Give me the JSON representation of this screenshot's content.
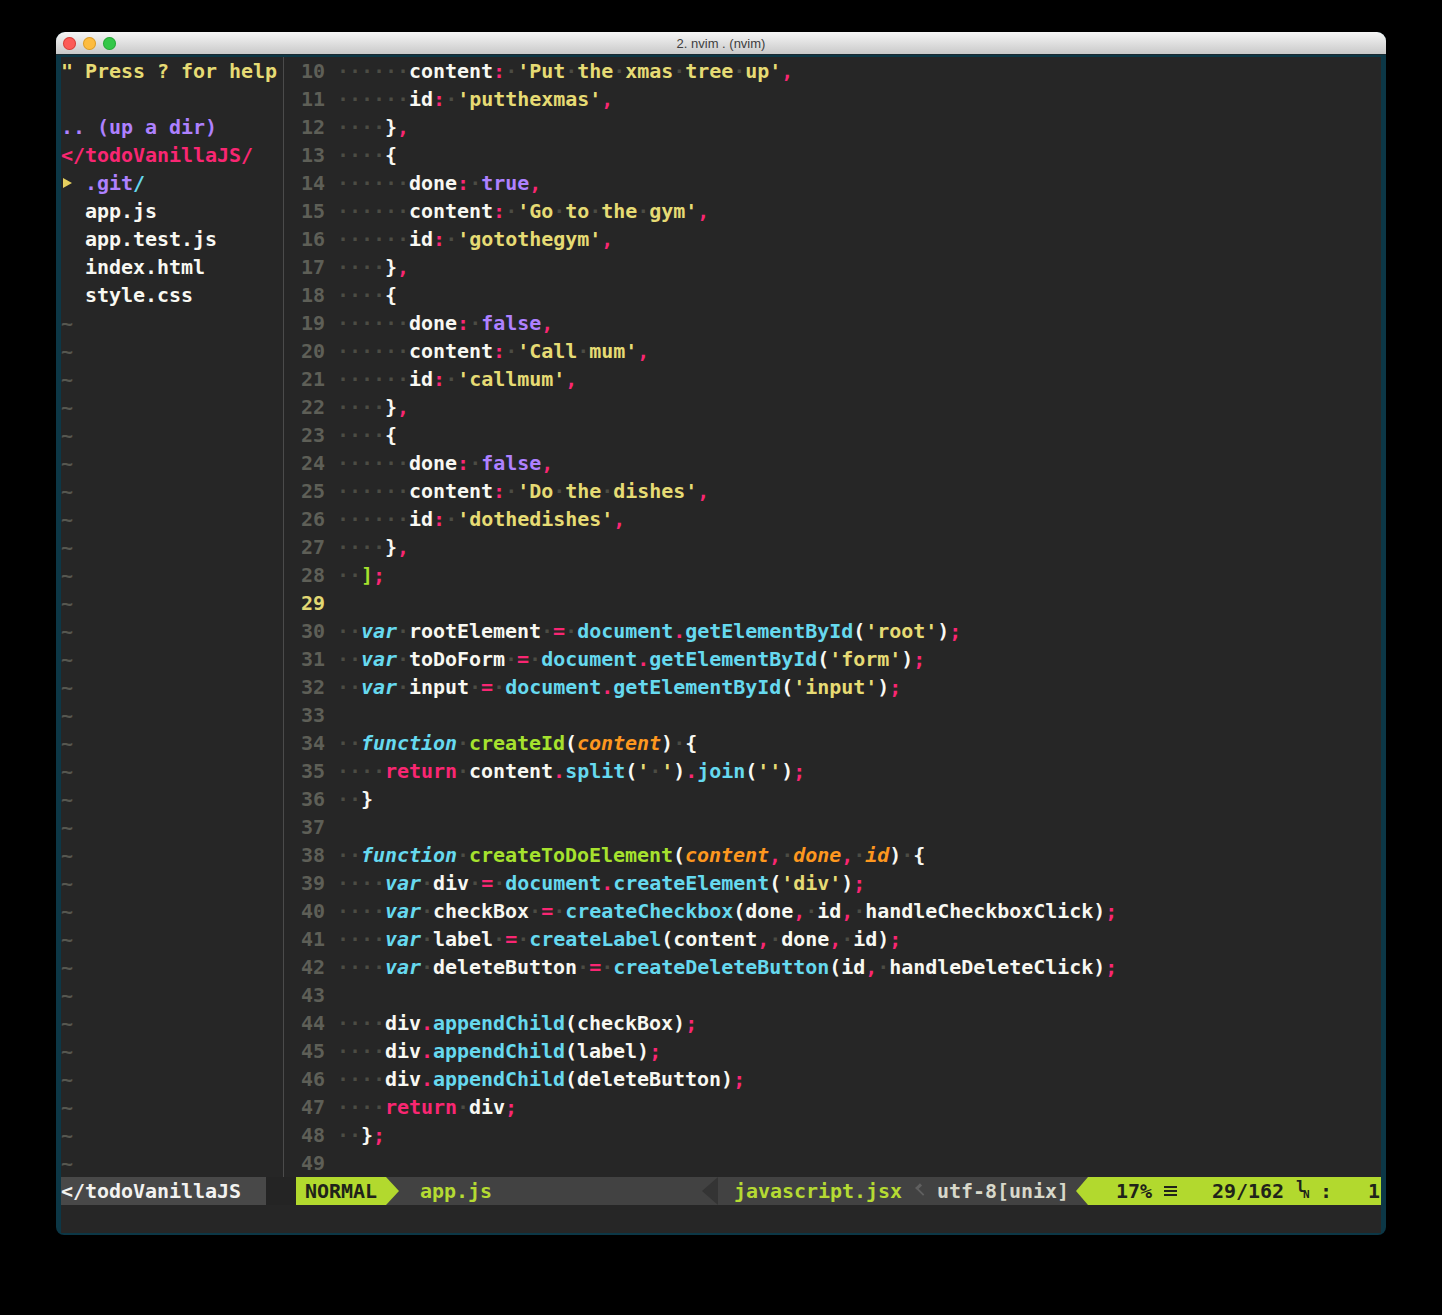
{
  "window": {
    "title": "2. nvim . (nvim)",
    "traffic_lights": [
      "close",
      "minimize",
      "zoom"
    ]
  },
  "sidebar": {
    "help_line": "\" Press ? for help",
    "up_dir": ".. (up a dir)",
    "root": "</todoVanillaJS/",
    "dir_arrow": "▸",
    "dir_name": ".git",
    "dir_slash": "/",
    "files": [
      "app.js",
      "app.test.js",
      "index.html",
      "style.css"
    ],
    "tilde": "~",
    "tilde_count": 31
  },
  "editor": {
    "lines": [
      {
        "n": "10",
        "t": [
          [
            "w",
            "      content"
          ],
          [
            "p",
            ":"
          ],
          [
            "w",
            " "
          ],
          [
            "y",
            "'Put the xmas tree up'"
          ],
          [
            "p",
            ","
          ]
        ]
      },
      {
        "n": "11",
        "t": [
          [
            "w",
            "      id"
          ],
          [
            "p",
            ":"
          ],
          [
            "w",
            " "
          ],
          [
            "y",
            "'putthexmas'"
          ],
          [
            "p",
            ","
          ]
        ]
      },
      {
        "n": "12",
        "t": [
          [
            "w",
            "    }"
          ],
          [
            "p",
            ","
          ]
        ]
      },
      {
        "n": "13",
        "t": [
          [
            "w",
            "    {"
          ]
        ]
      },
      {
        "n": "14",
        "t": [
          [
            "w",
            "      done"
          ],
          [
            "p",
            ":"
          ],
          [
            "w",
            " "
          ],
          [
            "v",
            "true"
          ],
          [
            "p",
            ","
          ]
        ]
      },
      {
        "n": "15",
        "t": [
          [
            "w",
            "      content"
          ],
          [
            "p",
            ":"
          ],
          [
            "w",
            " "
          ],
          [
            "y",
            "'Go to the gym'"
          ],
          [
            "p",
            ","
          ]
        ]
      },
      {
        "n": "16",
        "t": [
          [
            "w",
            "      id"
          ],
          [
            "p",
            ":"
          ],
          [
            "w",
            " "
          ],
          [
            "y",
            "'gotothegym'"
          ],
          [
            "p",
            ","
          ]
        ]
      },
      {
        "n": "17",
        "t": [
          [
            "w",
            "    }"
          ],
          [
            "p",
            ","
          ]
        ]
      },
      {
        "n": "18",
        "t": [
          [
            "w",
            "    {"
          ]
        ]
      },
      {
        "n": "19",
        "t": [
          [
            "w",
            "      done"
          ],
          [
            "p",
            ":"
          ],
          [
            "w",
            " "
          ],
          [
            "v",
            "false"
          ],
          [
            "p",
            ","
          ]
        ]
      },
      {
        "n": "20",
        "t": [
          [
            "w",
            "      content"
          ],
          [
            "p",
            ":"
          ],
          [
            "w",
            " "
          ],
          [
            "y",
            "'Call mum'"
          ],
          [
            "p",
            ","
          ]
        ]
      },
      {
        "n": "21",
        "t": [
          [
            "w",
            "      id"
          ],
          [
            "p",
            ":"
          ],
          [
            "w",
            " "
          ],
          [
            "y",
            "'callmum'"
          ],
          [
            "p",
            ","
          ]
        ]
      },
      {
        "n": "22",
        "t": [
          [
            "w",
            "    }"
          ],
          [
            "p",
            ","
          ]
        ]
      },
      {
        "n": "23",
        "t": [
          [
            "w",
            "    {"
          ]
        ]
      },
      {
        "n": "24",
        "t": [
          [
            "w",
            "      done"
          ],
          [
            "p",
            ":"
          ],
          [
            "w",
            " "
          ],
          [
            "v",
            "false"
          ],
          [
            "p",
            ","
          ]
        ]
      },
      {
        "n": "25",
        "t": [
          [
            "w",
            "      content"
          ],
          [
            "p",
            ":"
          ],
          [
            "w",
            " "
          ],
          [
            "y",
            "'Do the dishes'"
          ],
          [
            "p",
            ","
          ]
        ]
      },
      {
        "n": "26",
        "t": [
          [
            "w",
            "      id"
          ],
          [
            "p",
            ":"
          ],
          [
            "w",
            " "
          ],
          [
            "y",
            "'dothedishes'"
          ],
          [
            "p",
            ","
          ]
        ]
      },
      {
        "n": "27",
        "t": [
          [
            "w",
            "    }"
          ],
          [
            "p",
            ","
          ]
        ]
      },
      {
        "n": "28",
        "t": [
          [
            "w",
            "  "
          ],
          [
            "g",
            "]"
          ],
          [
            "p",
            ";"
          ]
        ]
      },
      {
        "n": "29",
        "cur": true,
        "t": []
      },
      {
        "n": "30",
        "t": [
          [
            "w",
            "  "
          ],
          [
            "k",
            "var"
          ],
          [
            "w",
            " rootElement "
          ],
          [
            "p",
            "="
          ],
          [
            "w",
            " "
          ],
          [
            "c",
            "document"
          ],
          [
            "p",
            "."
          ],
          [
            "c",
            "getElementById"
          ],
          [
            "w",
            "("
          ],
          [
            "y",
            "'root'"
          ],
          [
            "w",
            ")"
          ],
          [
            "p",
            ";"
          ]
        ]
      },
      {
        "n": "31",
        "t": [
          [
            "w",
            "  "
          ],
          [
            "k",
            "var"
          ],
          [
            "w",
            " toDoForm "
          ],
          [
            "p",
            "="
          ],
          [
            "w",
            " "
          ],
          [
            "c",
            "document"
          ],
          [
            "p",
            "."
          ],
          [
            "c",
            "getElementById"
          ],
          [
            "w",
            "("
          ],
          [
            "y",
            "'form'"
          ],
          [
            "w",
            ")"
          ],
          [
            "p",
            ";"
          ]
        ]
      },
      {
        "n": "32",
        "t": [
          [
            "w",
            "  "
          ],
          [
            "k",
            "var"
          ],
          [
            "w",
            " input "
          ],
          [
            "p",
            "="
          ],
          [
            "w",
            " "
          ],
          [
            "c",
            "document"
          ],
          [
            "p",
            "."
          ],
          [
            "c",
            "getElementById"
          ],
          [
            "w",
            "("
          ],
          [
            "y",
            "'input'"
          ],
          [
            "w",
            ")"
          ],
          [
            "p",
            ";"
          ]
        ]
      },
      {
        "n": "33",
        "t": []
      },
      {
        "n": "34",
        "t": [
          [
            "w",
            "  "
          ],
          [
            "k",
            "function"
          ],
          [
            "w",
            " "
          ],
          [
            "g",
            "createId"
          ],
          [
            "w",
            "("
          ],
          [
            "o",
            "content"
          ],
          [
            "w",
            ") {"
          ]
        ]
      },
      {
        "n": "35",
        "t": [
          [
            "w",
            "    "
          ],
          [
            "p",
            "return"
          ],
          [
            "w",
            " content"
          ],
          [
            "p",
            "."
          ],
          [
            "c",
            "split"
          ],
          [
            "w",
            "("
          ],
          [
            "y",
            "' '"
          ],
          [
            "w",
            ")"
          ],
          [
            "p",
            "."
          ],
          [
            "c",
            "join"
          ],
          [
            "w",
            "("
          ],
          [
            "y",
            "''"
          ],
          [
            "w",
            ")"
          ],
          [
            "p",
            ";"
          ]
        ]
      },
      {
        "n": "36",
        "t": [
          [
            "w",
            "  }"
          ]
        ]
      },
      {
        "n": "37",
        "t": []
      },
      {
        "n": "38",
        "t": [
          [
            "w",
            "  "
          ],
          [
            "k",
            "function"
          ],
          [
            "w",
            " "
          ],
          [
            "g",
            "createToDoElement"
          ],
          [
            "w",
            "("
          ],
          [
            "o",
            "content"
          ],
          [
            "p",
            ","
          ],
          [
            "w",
            " "
          ],
          [
            "o",
            "done"
          ],
          [
            "p",
            ","
          ],
          [
            "w",
            " "
          ],
          [
            "o",
            "id"
          ],
          [
            "w",
            ") {"
          ]
        ]
      },
      {
        "n": "39",
        "t": [
          [
            "w",
            "    "
          ],
          [
            "k",
            "var"
          ],
          [
            "w",
            " div "
          ],
          [
            "p",
            "="
          ],
          [
            "w",
            " "
          ],
          [
            "c",
            "document"
          ],
          [
            "p",
            "."
          ],
          [
            "c",
            "createElement"
          ],
          [
            "w",
            "("
          ],
          [
            "y",
            "'div'"
          ],
          [
            "w",
            ")"
          ],
          [
            "p",
            ";"
          ]
        ]
      },
      {
        "n": "40",
        "t": [
          [
            "w",
            "    "
          ],
          [
            "k",
            "var"
          ],
          [
            "w",
            " checkBox "
          ],
          [
            "p",
            "="
          ],
          [
            "w",
            " "
          ],
          [
            "c",
            "createCheckbox"
          ],
          [
            "w",
            "(done"
          ],
          [
            "p",
            ","
          ],
          [
            "w",
            " id"
          ],
          [
            "p",
            ","
          ],
          [
            "w",
            " handleCheckboxClick)"
          ],
          [
            "p",
            ";"
          ]
        ]
      },
      {
        "n": "41",
        "t": [
          [
            "w",
            "    "
          ],
          [
            "k",
            "var"
          ],
          [
            "w",
            " label "
          ],
          [
            "p",
            "="
          ],
          [
            "w",
            " "
          ],
          [
            "c",
            "createLabel"
          ],
          [
            "w",
            "(content"
          ],
          [
            "p",
            ","
          ],
          [
            "w",
            " done"
          ],
          [
            "p",
            ","
          ],
          [
            "w",
            " id)"
          ],
          [
            "p",
            ";"
          ]
        ]
      },
      {
        "n": "42",
        "t": [
          [
            "w",
            "    "
          ],
          [
            "k",
            "var"
          ],
          [
            "w",
            " deleteButton "
          ],
          [
            "p",
            "="
          ],
          [
            "w",
            " "
          ],
          [
            "c",
            "createDeleteButton"
          ],
          [
            "w",
            "(id"
          ],
          [
            "p",
            ","
          ],
          [
            "w",
            " handleDeleteClick)"
          ],
          [
            "p",
            ";"
          ]
        ]
      },
      {
        "n": "43",
        "t": []
      },
      {
        "n": "44",
        "t": [
          [
            "w",
            "    div"
          ],
          [
            "p",
            "."
          ],
          [
            "c",
            "appendChild"
          ],
          [
            "w",
            "(checkBox)"
          ],
          [
            "p",
            ";"
          ]
        ]
      },
      {
        "n": "45",
        "t": [
          [
            "w",
            "    div"
          ],
          [
            "p",
            "."
          ],
          [
            "c",
            "appendChild"
          ],
          [
            "w",
            "(label)"
          ],
          [
            "p",
            ";"
          ]
        ]
      },
      {
        "n": "46",
        "t": [
          [
            "w",
            "    div"
          ],
          [
            "p",
            "."
          ],
          [
            "c",
            "appendChild"
          ],
          [
            "w",
            "(deleteButton)"
          ],
          [
            "p",
            ";"
          ]
        ]
      },
      {
        "n": "47",
        "t": [
          [
            "w",
            "    "
          ],
          [
            "p",
            "return"
          ],
          [
            "w",
            " div"
          ],
          [
            "p",
            ";"
          ]
        ]
      },
      {
        "n": "48",
        "t": [
          [
            "w",
            "  }"
          ],
          [
            "p",
            ";"
          ]
        ]
      },
      {
        "n": "49",
        "t": []
      }
    ]
  },
  "statusbar": {
    "tree_segment": "</todoVanillaJS",
    "mode": "NORMAL",
    "file": "app.js",
    "filetype": "javascript.jsx",
    "encoding": "utf-8[unix]",
    "lines_symbol": "☰",
    "percent": "17%",
    "position": "29/162",
    "ln_symbol": "㏑",
    "colon": ":",
    "column": "1"
  },
  "colors": {
    "background": "#000000",
    "terminal_padding": "#0c3746",
    "editor_bg": "#262626",
    "foreground": "#f8f8f2",
    "yellow": "#e6db74",
    "pink": "#f92672",
    "cyan": "#66d9ef",
    "green": "#a6e22e",
    "purple": "#ae81ff",
    "orange": "#fd971f",
    "line_number": "#5e5f57",
    "cursor_line_number": "#e2d874",
    "whitespace_dot": "#4c4c44",
    "statusline_green": "#b2d92e",
    "statusline_grey": "#484848"
  }
}
